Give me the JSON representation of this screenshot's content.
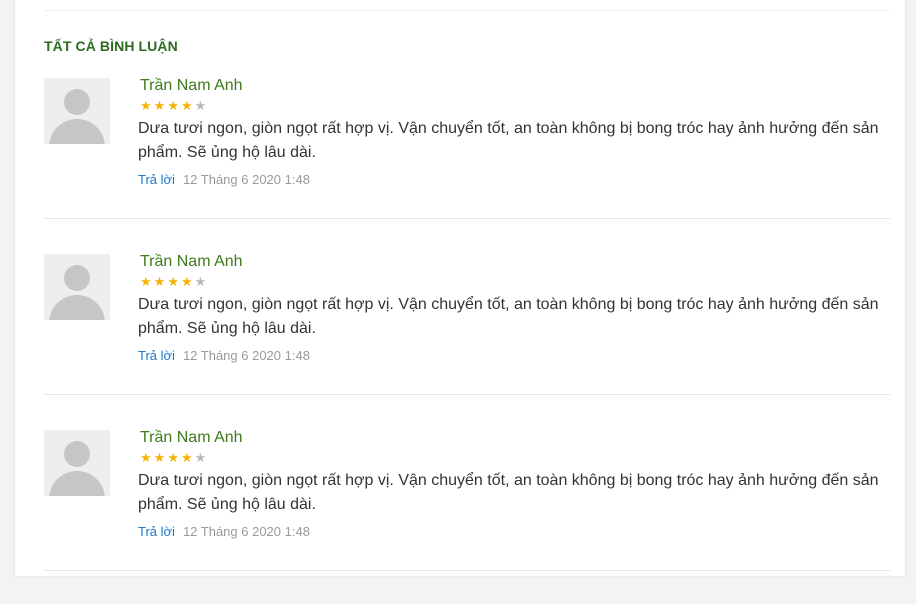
{
  "section": {
    "title": "TẤT CẢ BÌNH LUẬN"
  },
  "comments": [
    {
      "author": "Trần Nam Anh",
      "rating": 4,
      "rating_max": 5,
      "text": "Dưa tươi ngon, giòn ngọt rất hợp vị. Vận chuyển tốt, an toàn không bị bong tróc hay ảnh hưởng đến sản phẩm. Sẽ ủng hộ lâu dài.",
      "reply_label": "Trả lời",
      "date": "12 Tháng 6 2020 1:48"
    },
    {
      "author": "Trần Nam Anh",
      "rating": 4,
      "rating_max": 5,
      "text": "Dưa tươi ngon, giòn ngọt rất hợp vị. Vận chuyển tốt, an toàn không bị bong tróc hay ảnh hưởng đến sản phẩm. Sẽ ủng hộ lâu dài.",
      "reply_label": "Trả lời",
      "date": "12 Tháng 6 2020 1:48"
    },
    {
      "author": "Trần Nam Anh",
      "rating": 4,
      "rating_max": 5,
      "text": "Dưa tươi ngon, giòn ngọt rất hợp vị. Vận chuyển tốt, an toàn không bị bong tróc hay ảnh hưởng đến sản phẩm. Sẽ ủng hộ lâu dài.",
      "reply_label": "Trả lời",
      "date": "12 Tháng 6 2020 1:48"
    }
  ],
  "colors": {
    "title": "#2e6b1e",
    "author": "#3f7a1a",
    "star_on": "#f5b301",
    "star_off": "#b9b9b9",
    "reply_link": "#1976d2"
  }
}
